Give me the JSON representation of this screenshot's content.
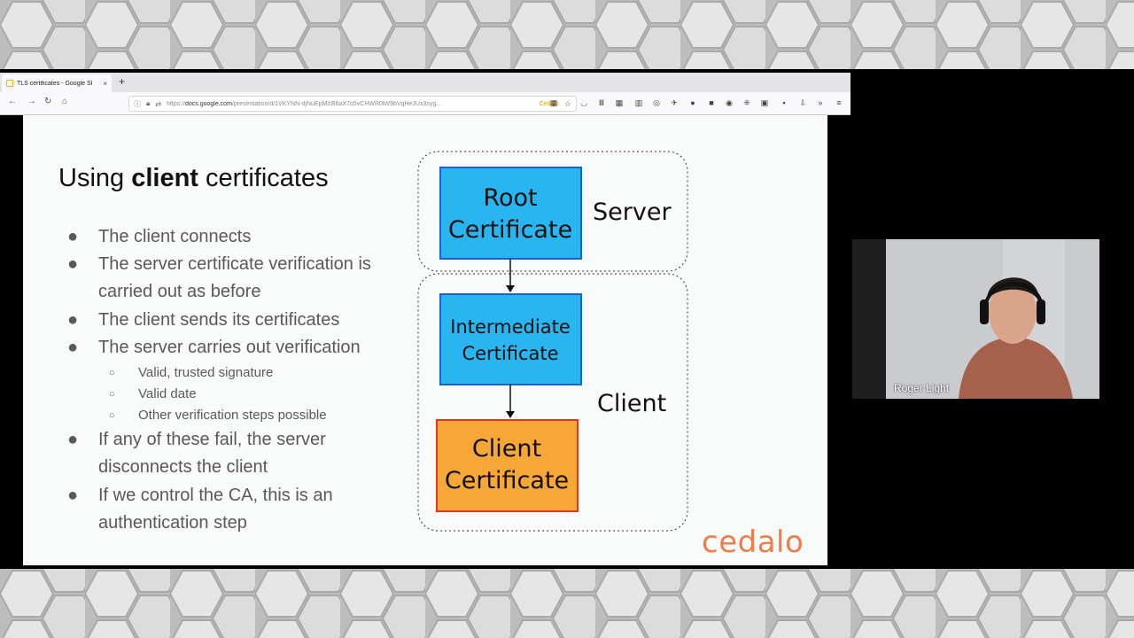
{
  "browser": {
    "tab_title": "TLS certificates - Google Sl",
    "tab_close": "×",
    "new_tab": "+",
    "url_domain": "docs.google.com",
    "url_prefix": "https://",
    "url_path": "/presentation/d/1VKYNN-djNuEpMXB6aX7o5vCHWR0lW9bVqHeJUx3syg...",
    "url_badge": "Cedalo"
  },
  "slide": {
    "title_pre": "Using ",
    "title_bold": "client",
    "title_post": " certificates",
    "bullets": [
      "The client connects",
      "The server certificate verification is carried out as before",
      "The client sends its certificates",
      "The server carries out verification",
      "If any of these fail, the server disconnects the client",
      "If we control the CA, this is an authentication step"
    ],
    "sub_bullets": [
      "Valid, trusted signature",
      "Valid date",
      "Other verification steps possible"
    ],
    "bullet_glyph": "●",
    "sub_glyph": "○",
    "logo": "cedalo"
  },
  "diagram": {
    "root_line1": "Root",
    "root_line2": "Certificate",
    "intermediate_line1": "Intermediate",
    "intermediate_line2": "Certificate",
    "client_line1": "Client",
    "client_line2": "Certificate",
    "server_label": "Server",
    "client_label": "Client",
    "colors": {
      "blue_fill": "#29b5ef",
      "blue_stroke": "#1f5fd6",
      "orange_fill": "#f7a638",
      "orange_stroke": "#e0362c"
    }
  },
  "webcam": {
    "presenter_name": "Roger Light"
  }
}
